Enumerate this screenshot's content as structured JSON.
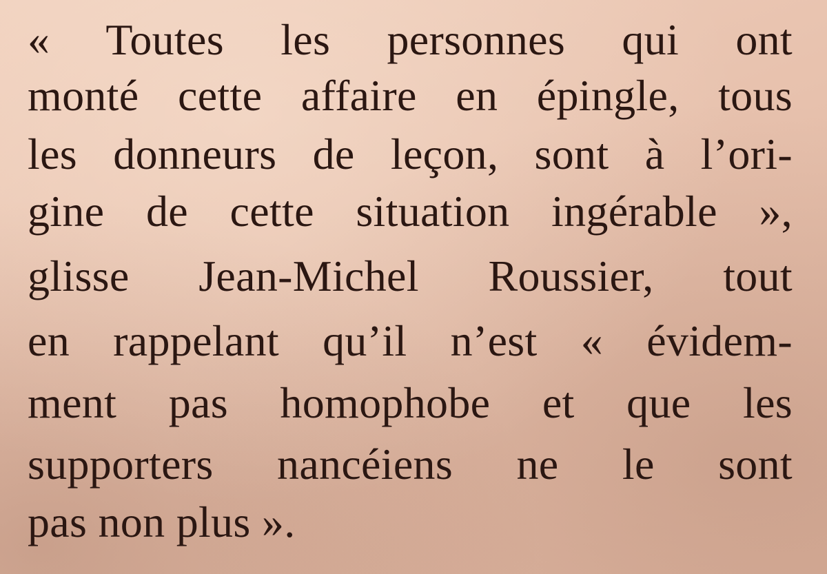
{
  "article": {
    "lines": [
      "« Toutes les personnes qui ont",
      "monté cette affaire en épingle, tous",
      "les donneurs de leçon, sont à l’ori-",
      "gine de cette situation ingérable »,",
      "glisse Jean-Michel Roussier, tout",
      "en rappelant qu’il n’est « évidem-",
      "ment pas homophobe et que les",
      "supporters nancéiens ne le sont",
      "pas non plus »."
    ]
  }
}
